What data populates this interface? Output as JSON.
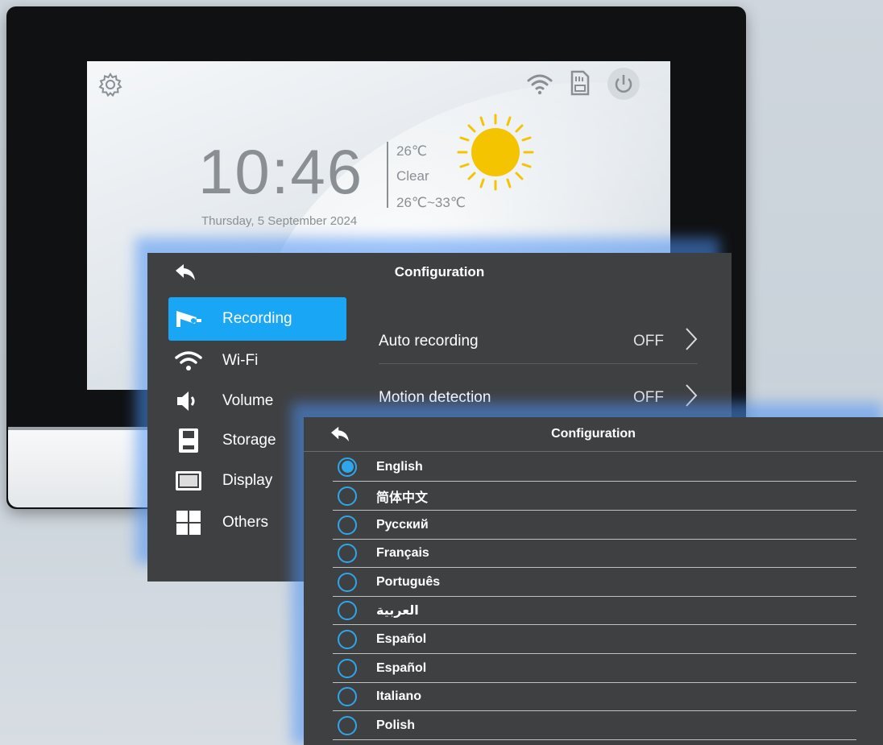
{
  "home": {
    "time": "10:46",
    "date": "Thursday, 5 September 2024",
    "weather": {
      "temp": "26℃",
      "condition": "Clear",
      "range": "26℃~33℃"
    }
  },
  "config_panel": {
    "title": "Configuration",
    "menu": [
      {
        "label": "Recording",
        "icon": "camera-icon",
        "active": true
      },
      {
        "label": "Wi-Fi",
        "icon": "wifi-icon"
      },
      {
        "label": "Volume",
        "icon": "speaker-icon"
      },
      {
        "label": "Storage",
        "icon": "sd-card-icon"
      },
      {
        "label": "Display",
        "icon": "display-icon"
      },
      {
        "label": "Others",
        "icon": "grid-icon"
      }
    ],
    "settings": [
      {
        "label": "Auto recording",
        "value": "OFF"
      },
      {
        "label": "Motion detection",
        "value": "OFF"
      }
    ]
  },
  "language_panel": {
    "title": "Configuration",
    "languages": [
      {
        "label": "English",
        "selected": true
      },
      {
        "label": "简体中文"
      },
      {
        "label": "Русский"
      },
      {
        "label": "Français"
      },
      {
        "label": "Português"
      },
      {
        "label": "العربية"
      },
      {
        "label": "Español"
      },
      {
        "label": "Español"
      },
      {
        "label": "Italiano"
      },
      {
        "label": "Polish"
      }
    ]
  },
  "colors": {
    "accent": "#18a6f5",
    "panel_bg": "#3f4042",
    "glow": "#4b91f5",
    "sun": "#f5c400"
  }
}
